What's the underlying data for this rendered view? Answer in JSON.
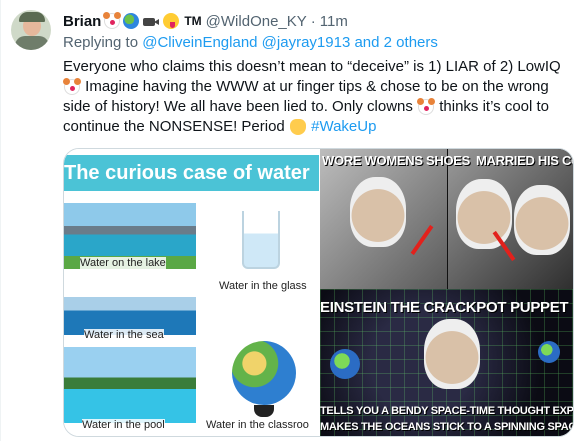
{
  "tweet": {
    "author_name": "Brian",
    "author_tm": "TM",
    "handle": "@WildOne_KY",
    "separator": "·",
    "timestamp": "11m",
    "replying_prefix": "Replying to",
    "replying_users": "@CliveinEngland @jayray1913",
    "replying_and": "and",
    "replying_others": "2 others",
    "text_line1": "Everyone who claims this doesn’t mean to “deceive” is 1) LIAR of 2)  LowIQ",
    "text_line2": "Imagine having the WWW at ur finger tips & chose to be on the wrong",
    "text_line3": "side of history! We all have been lied to. Only clowns",
    "text_line3b": "thinks it’s cool to",
    "text_line4": "continue the NONSENSE! Period",
    "hashtag": "#WakeUp",
    "emoji_names": [
      "clown-emoji",
      "globe-emoji",
      "camera-emoji",
      "tongue-emoji",
      "waving-hand-emoji"
    ]
  },
  "media": {
    "left": {
      "title": "The curious case of water",
      "captions": {
        "lake": "Water on the lake",
        "glass": "Water in the glass",
        "sea": "Water in the sea",
        "pool": "Water in the pool",
        "classroom": "Water in the classroo"
      }
    },
    "right": {
      "top_left": "WORE WOMENS SHOES",
      "top_right": "MARRIED HIS COUSIN",
      "middle": "EINSTEIN THE CRACKPOT PUPPET",
      "bottom_line1": "TELLS YOU A BENDY SPACE-TIME THOUGHT EXPERIMENT",
      "bottom_line2": "MAKES THE OCEANS STICK TO A SPINNING SPACEBALL"
    }
  },
  "colors": {
    "link": "#1d9bf0",
    "muted": "#536471",
    "banner": "#4bc3d6"
  }
}
